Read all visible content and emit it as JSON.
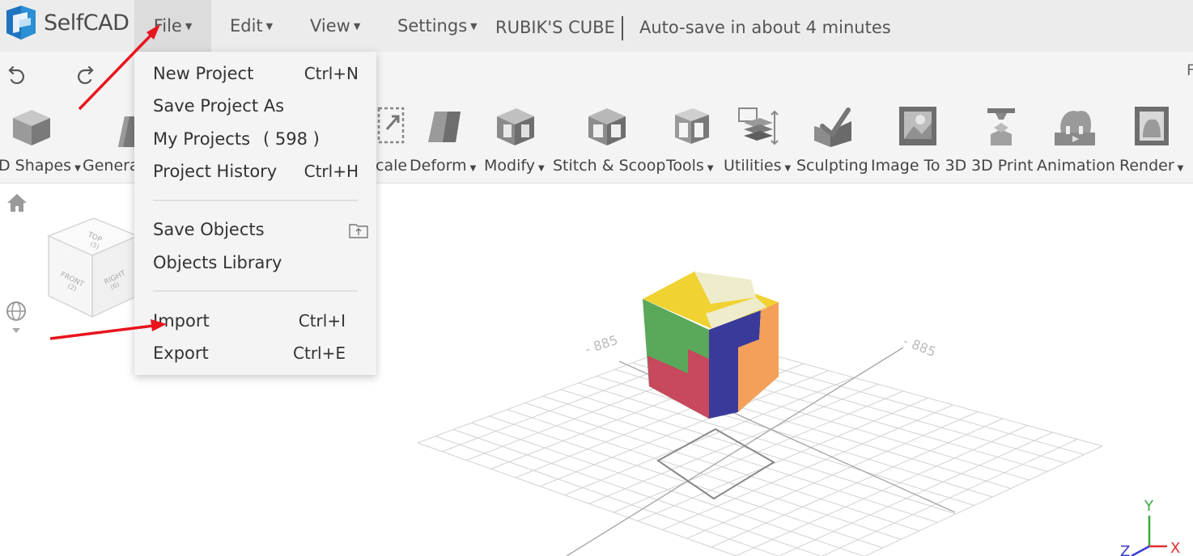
{
  "app": {
    "logo_text": "SelfCAD",
    "brand_color": "#2b8fd6"
  },
  "menubar": {
    "file": "File",
    "edit": "Edit",
    "view": "View",
    "settings": "Settings",
    "project_name": "RUBIK'S CUBE",
    "autosave": "Auto-save in about 4 minutes"
  },
  "undobar": {
    "right_text": "F"
  },
  "toolbar": {
    "items": [
      {
        "label": "D Shapes",
        "icon": "cube-icon",
        "dropdown": true
      },
      {
        "label": "Genera",
        "icon": "generator-icon",
        "dropdown": false
      },
      {
        "label": "cale",
        "icon": "scale-icon",
        "dropdown": false
      },
      {
        "label": "Deform",
        "icon": "deform-icon",
        "dropdown": true
      },
      {
        "label": "Modify",
        "icon": "modify-icon",
        "dropdown": true
      },
      {
        "label": "Stitch & Scoop",
        "icon": "stitch-scoop-icon",
        "dropdown": false
      },
      {
        "label": "Tools",
        "icon": "tools-icon",
        "dropdown": true
      },
      {
        "label": "Utilities",
        "icon": "utilities-icon",
        "dropdown": true
      },
      {
        "label": "Sculpting",
        "icon": "sculpting-icon",
        "dropdown": false
      },
      {
        "label": "Image To 3D",
        "icon": "image-to-3d-icon",
        "dropdown": false
      },
      {
        "label": "3D Print",
        "icon": "3d-print-icon",
        "dropdown": false
      },
      {
        "label": "Animation",
        "icon": "animation-icon",
        "dropdown": false
      },
      {
        "label": "Render",
        "icon": "render-icon",
        "dropdown": true
      }
    ]
  },
  "viewcube": {
    "top": "TOP",
    "top_key": "(5)",
    "front": "FRONT",
    "front_key": "(2)",
    "right": "RIGHT",
    "right_key": "(6)"
  },
  "file_menu": {
    "items": [
      {
        "label": "New Project",
        "shortcut": "Ctrl+N"
      },
      {
        "label": "Save Project As",
        "shortcut": ""
      },
      {
        "label": "My Projects",
        "count": "( 598 )"
      },
      {
        "label": "Project History",
        "shortcut": "Ctrl+H"
      },
      {
        "label": "Save Objects",
        "icon": "upload-folder-icon"
      },
      {
        "label": "Objects Library",
        "shortcut": ""
      },
      {
        "label": "Import",
        "shortcut": "Ctrl+I"
      },
      {
        "label": "Export",
        "shortcut": "Ctrl+E"
      }
    ]
  },
  "scene": {
    "grid_label_left": "- 885",
    "grid_label_right": "- 885",
    "axis_y": "Y",
    "axis_x": "X",
    "axis_z": "Z",
    "cube_colors": [
      "#f0d232",
      "#efeccc",
      "#5aa85a",
      "#3a3a9a",
      "#f4a05a",
      "#c8485e"
    ]
  },
  "annotations": {
    "arrow_color": "#e8141e"
  }
}
